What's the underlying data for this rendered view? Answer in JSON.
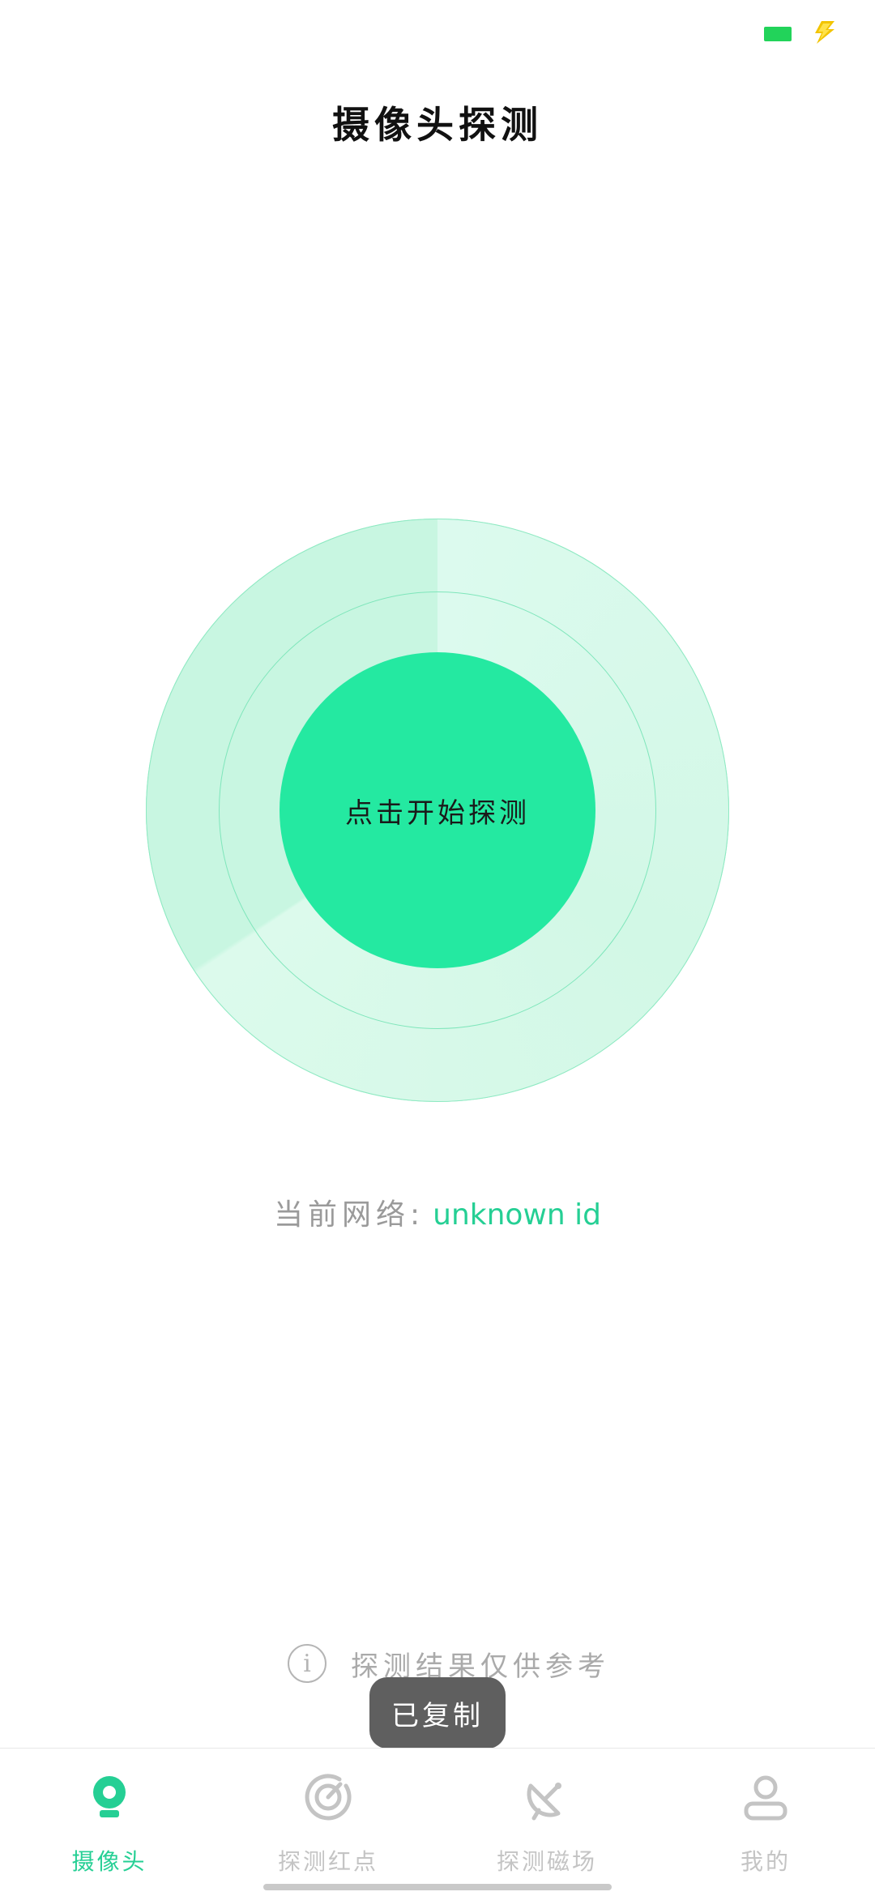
{
  "colors": {
    "accent": "#24e9a1",
    "accent_text": "#25cf94",
    "ring_fill": "#c8f6e1",
    "battery": "#22d35a",
    "bolt": "#f2c400",
    "muted_text": "#9a9a9a",
    "toast_bg": "#5f5f5f"
  },
  "status_bar": {
    "icons": [
      "battery-icon",
      "charging-bolt-icon"
    ]
  },
  "header": {
    "title": "摄像头探测"
  },
  "radar": {
    "button_label": "点击开始探测"
  },
  "network": {
    "prefix": "当前网络:",
    "value": "unknown id"
  },
  "disclaimer": {
    "icon": "info-icon",
    "icon_glyph": "i",
    "text": "探测结果仅供参考"
  },
  "toast": {
    "text": "已复制"
  },
  "tabs": [
    {
      "label": "摄像头",
      "icon": "camera-icon",
      "active": true
    },
    {
      "label": "探测红点",
      "icon": "radar-icon",
      "active": false
    },
    {
      "label": "探测磁场",
      "icon": "satellite-dish-icon",
      "active": false
    },
    {
      "label": "我的",
      "icon": "user-icon",
      "active": false
    }
  ]
}
